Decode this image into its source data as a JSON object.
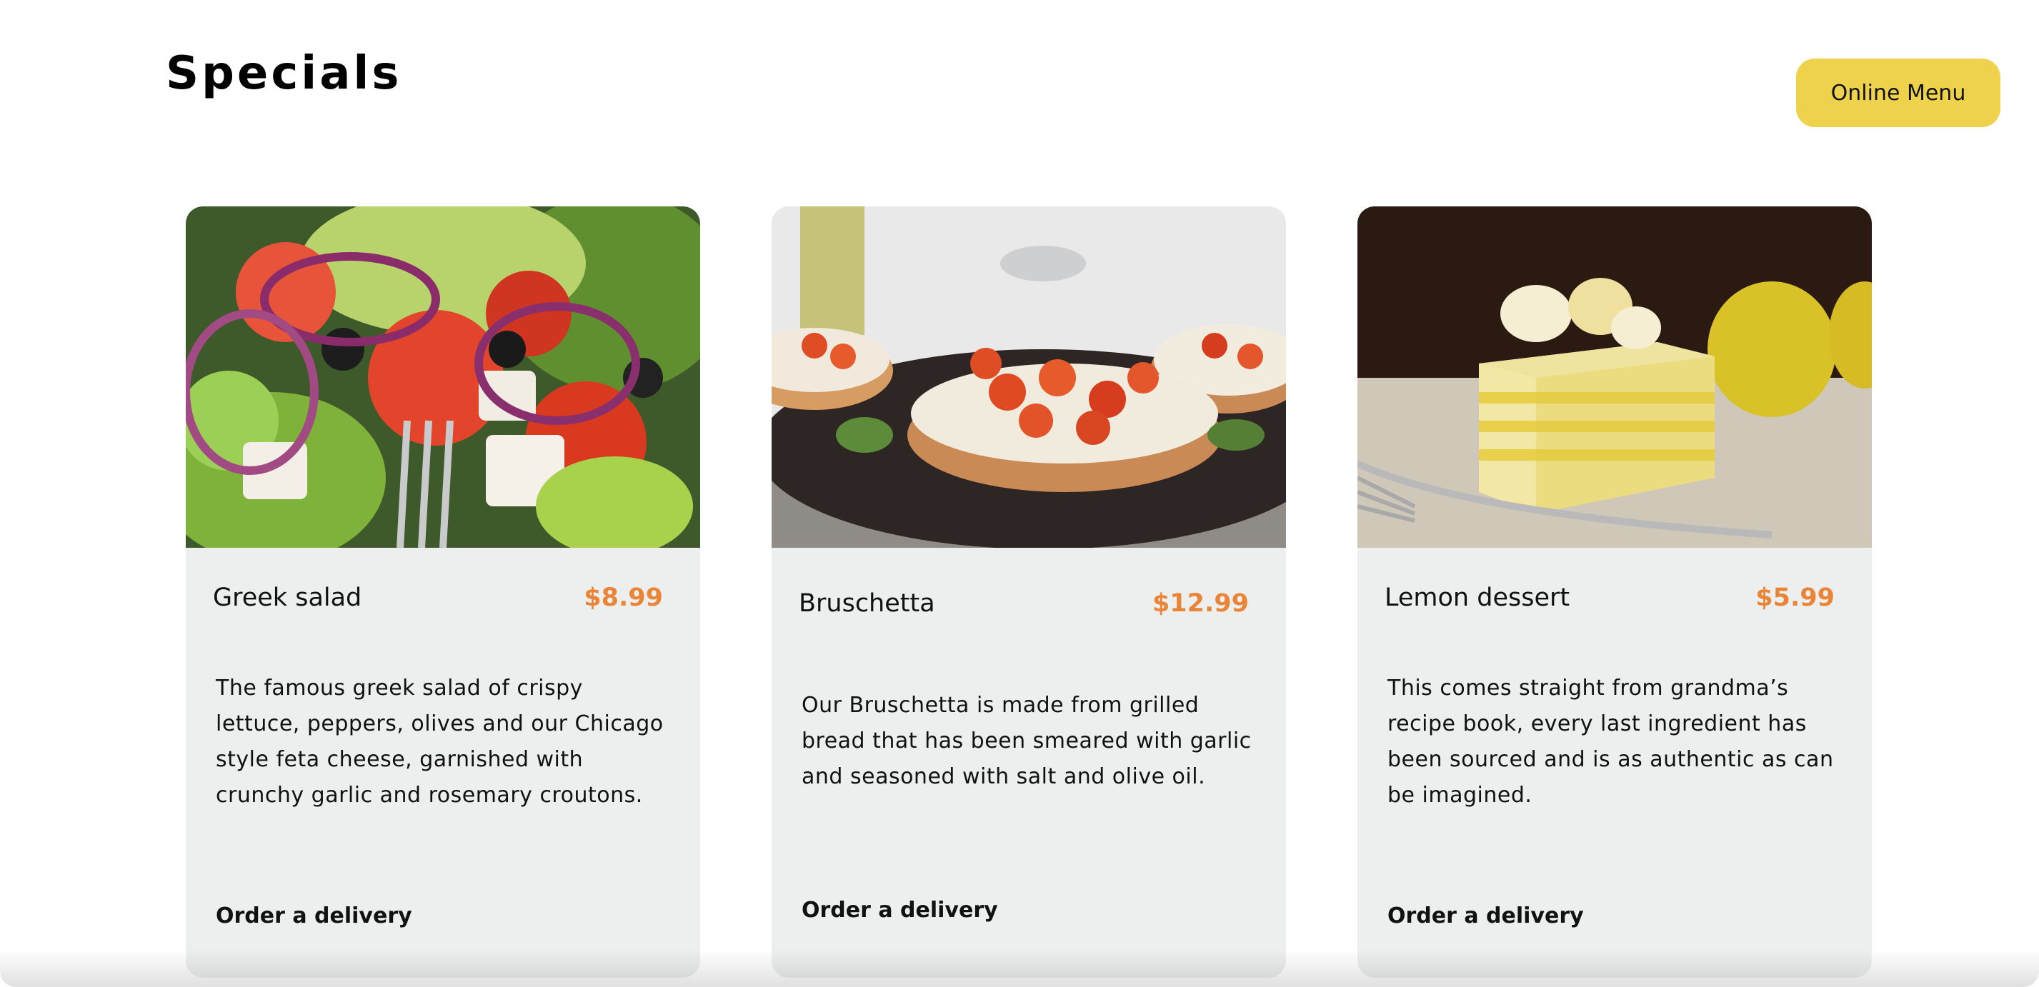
{
  "section": {
    "title": "Specials"
  },
  "header": {
    "online_menu_label": "Online Menu"
  },
  "cards": [
    {
      "title": "Greek salad",
      "price": "$8.99",
      "description": "The famous greek salad of crispy lettuce, peppers, olives and our Chicago style feta cheese, garnished with crunchy garlic and rosemary croutons.",
      "order_label": "Order a delivery",
      "image_icon": "greek-salad-photo"
    },
    {
      "title": "Bruschetta",
      "price": "$12.99",
      "description": "Our Bruschetta is made from grilled bread that has been smeared with garlic and seasoned with salt and olive oil.",
      "order_label": "Order a delivery",
      "image_icon": "bruschetta-photo"
    },
    {
      "title": "Lemon dessert",
      "price": "$5.99",
      "description": "This comes straight from grandma’s recipe book, every last ingredient has been sourced and is as authentic as can be imagined.",
      "order_label": "Order a delivery",
      "image_icon": "lemon-dessert-photo"
    }
  ],
  "colors": {
    "accent_yellow": "#eed24b",
    "price_orange": "#ea8537",
    "card_bg": "#edeeee"
  }
}
